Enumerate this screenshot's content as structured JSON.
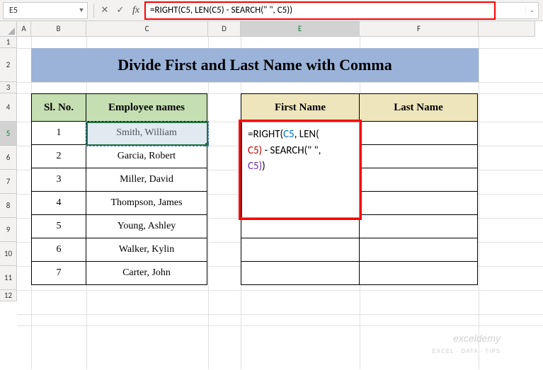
{
  "namebox": "E5",
  "formula_bar": "=RIGHT(C5, LEN(C5) - SEARCH(\" \", C5))",
  "col_headers": [
    "A",
    "B",
    "C",
    "D",
    "E",
    "F"
  ],
  "row_headers": [
    "1",
    "2",
    "3",
    "4",
    "5",
    "6",
    "7",
    "8",
    "9",
    "10",
    "11",
    "12"
  ],
  "title": "Divide First and Last Name with Comma",
  "tbl1": {
    "h1": "Sl. No.",
    "h2": "Employee names",
    "rows": [
      {
        "n": "1",
        "name": "Smith, William"
      },
      {
        "n": "2",
        "name": "Garcia, Robert"
      },
      {
        "n": "3",
        "name": "Miller, David"
      },
      {
        "n": "4",
        "name": "Thompson, James"
      },
      {
        "n": "5",
        "name": "Young, Ashley"
      },
      {
        "n": "6",
        "name": "Walker, Kylin"
      },
      {
        "n": "7",
        "name": "Carter, John"
      }
    ]
  },
  "tbl2": {
    "h1": "First Name",
    "h2": "Last Name"
  },
  "overlay": {
    "p1a": "=RIGHT(",
    "p1b": "C5",
    "p1c": ", LEN(",
    "p2a": "C5",
    "p2b": ")",
    "p2c": " - SEARCH(\" \", ",
    "p3a": "C5",
    "p3b": ")",
    "p3c": ")"
  },
  "watermark": {
    "main": "exceldemy",
    "sub": "EXCEL · DATA · TIPS"
  }
}
